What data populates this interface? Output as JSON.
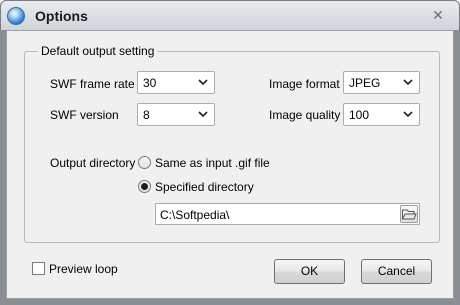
{
  "window": {
    "title": "Options"
  },
  "group": {
    "title": "Default output setting"
  },
  "fields": {
    "frame_rate": {
      "label": "SWF frame rate",
      "value": "30"
    },
    "swf_version": {
      "label": "SWF version",
      "value": "8"
    },
    "image_format": {
      "label": "Image format",
      "value": "JPEG"
    },
    "image_quality": {
      "label": "Image quality",
      "value": "100"
    }
  },
  "output": {
    "label": "Output directory",
    "option_same": "Same as input .gif file",
    "option_specified": "Specified directory",
    "selected": "specified",
    "path": "C:\\Softpedia\\"
  },
  "preview": {
    "label": "Preview loop",
    "checked": false
  },
  "buttons": {
    "ok": "OK",
    "cancel": "Cancel"
  },
  "icons": {
    "app": "app-globe-icon",
    "close": "close-icon",
    "dropdown": "chevron-down-icon",
    "browse": "folder-open-icon"
  }
}
